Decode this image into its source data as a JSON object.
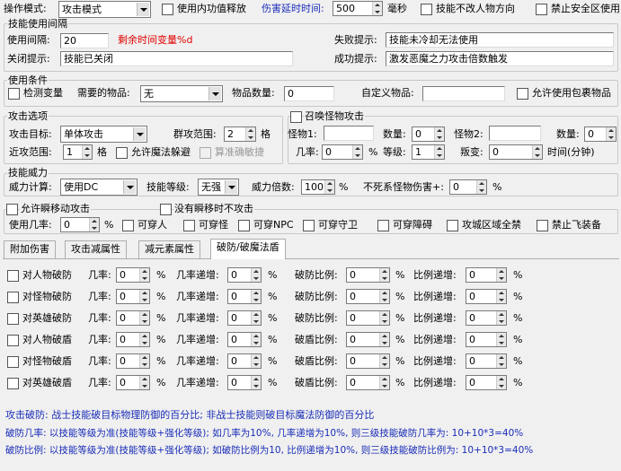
{
  "top": {
    "op_mode_label": "操作模式:",
    "op_mode_value": "攻击模式",
    "use_internal_label": "使用内功值释放",
    "delay_label": "伤害延时时间:",
    "delay_value": "500",
    "ms_label": "毫秒",
    "no_turn_label": "技能不改人物方向",
    "no_safe_label": "禁止安全区使用"
  },
  "interval": {
    "title": "技能使用间隔",
    "interval_label": "使用间隔:",
    "interval_value": "20",
    "remaining_text": "剩余时间变量%d",
    "fail_label": "失败提示:",
    "fail_value": "技能未冷却无法使用",
    "close_label": "关闭提示:",
    "close_value": "技能已关闭",
    "success_label": "成功提示:",
    "success_value": "激发恶魔之力攻击倍数触发"
  },
  "conditions": {
    "title": "使用条件",
    "check_var_label": "检测变量",
    "item_needed_label": "需要的物品:",
    "item_needed_value": "无",
    "item_qty_label": "物品数量:",
    "item_qty_value": "0",
    "custom_item_label": "自定义物品:",
    "custom_item_value": "",
    "allow_pack_label": "允许使用包裹物品"
  },
  "attack": {
    "title": "攻击选项",
    "target_label": "攻击目标:",
    "target_value": "单体攻击",
    "range_label": "群攻范围:",
    "range_value": "2",
    "grid_label": "格",
    "near_label": "近攻范围:",
    "near_value": "1",
    "grid_label2": "格",
    "allow_dodge_label": "允许魔法躲避",
    "precise_label": "算准确敏捷"
  },
  "summon": {
    "title": "召唤怪物攻击",
    "monster1_label": "怪物1:",
    "monster1_value": "",
    "qty1_label": "数量:",
    "qty1_value": "0",
    "monster2_label": "怪物2:",
    "monster2_value": "",
    "qty2_label": "数量:",
    "qty2_value": "0",
    "chance_label": "几率:",
    "chance_value": "0",
    "pct": "%",
    "level_label": "等级:",
    "level_value": "1",
    "mutate_label": "叛变:",
    "mutate_value": "0",
    "time_label": "时间(分钟)"
  },
  "power": {
    "title": "技能威力",
    "calc_label": "威力计算:",
    "calc_value": "使用DC",
    "level_label": "技能等级:",
    "level_value": "无强",
    "mult_label": "威力倍数:",
    "mult_value": "100",
    "pct": "%",
    "undead_label": "不死系怪物伤害+:",
    "undead_value": "0",
    "pct2": "%"
  },
  "move": {
    "allow_move_label": "允许瞬移动攻击",
    "no_move_label": "没有瞬移时不攻击",
    "chance_label": "使用几率:",
    "chance_value": "0",
    "pct": "%",
    "opts": [
      "可穿人",
      "可穿怪",
      "可穿NPC",
      "可穿守卫",
      "可穿障碍",
      "攻城区域全禁",
      "禁止飞装备"
    ]
  },
  "tabs": [
    "附加伤害",
    "攻击减属性",
    "减元素属性",
    "破防/破魔法盾"
  ],
  "rows": [
    {
      "name": "对人物破防",
      "ratio_label": "破防比例:"
    },
    {
      "name": "对怪物破防",
      "ratio_label": "破防比例:"
    },
    {
      "name": "对英雄破防",
      "ratio_label": "破防比例:"
    },
    {
      "name": "对人物破盾",
      "ratio_label": "破盾比例:"
    },
    {
      "name": "对怪物破盾",
      "ratio_label": "破盾比例:"
    },
    {
      "name": "对英雄破盾",
      "ratio_label": "破盾比例:"
    }
  ],
  "row_labels": {
    "chance": "几率:",
    "chance_inc": "几率递增:",
    "ratio_inc": "比例递增:",
    "value": "0",
    "pct": "%"
  },
  "notes": [
    "攻击破防: 战士技能破目标物理防御的百分比; 非战士技能则破目标魔法防御的百分比",
    "破防几率: 以技能等级为准(技能等级+强化等级); 如几率为10%, 几率递增为10%, 则三级技能破防几率为: 10+10*3=40%",
    "破防比例: 以技能等级为准(技能等级+强化等级); 如破防比例为10, 比例递增为10%, 则三级技能破防比例为: 10+10*3=40%"
  ]
}
